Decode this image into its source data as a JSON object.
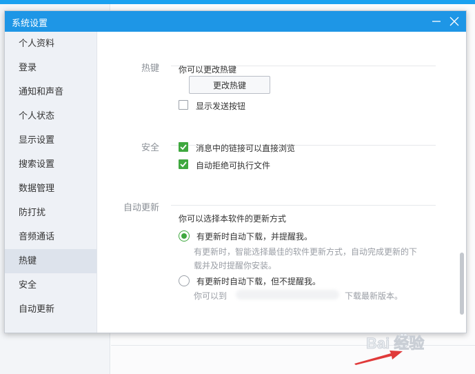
{
  "window": {
    "title": "系统设置"
  },
  "sidebar": {
    "items": [
      {
        "label": "个人资料"
      },
      {
        "label": "登录"
      },
      {
        "label": "通知和声音"
      },
      {
        "label": "个人状态"
      },
      {
        "label": "显示设置"
      },
      {
        "label": "搜索设置"
      },
      {
        "label": "数据管理"
      },
      {
        "label": "防打扰"
      },
      {
        "label": "音频通话"
      },
      {
        "label": "热键",
        "active": true
      },
      {
        "label": "安全"
      },
      {
        "label": "自动更新"
      }
    ]
  },
  "hotkey": {
    "section_label": "热键",
    "desc": "你可以更改热键",
    "button_label": "更改热键",
    "show_send_label": "显示发送按钮",
    "show_send_checked": false
  },
  "security": {
    "section_label": "安全",
    "option1_label": "消息中的链接可以直接浏览",
    "option1_checked": true,
    "option2_label": "自动拒绝可执行文件",
    "option2_checked": true
  },
  "update": {
    "section_label": "自动更新",
    "desc": "你可以选择本软件的更新方式",
    "option1_label": "有更新时自动下载，并提醒我。",
    "option1_desc_line1": "有更新时，智能选择最佳的软件更新方式，自动完成更新的下",
    "option1_desc_line2": "载并及时提醒你安装。",
    "option1_checked": true,
    "option2_label": "有更新时自动下载，但不提醒我。",
    "option2_desc_start": "你可以到",
    "option2_desc_end": "下载最新版本。",
    "option2_checked": false
  },
  "watermark": {
    "text": "Bai 经验",
    "icon": "paw-icon"
  },
  "colors": {
    "title_bar": "#1e96e6",
    "check_green": "#3fa83f",
    "active_nav": "#dde3ec"
  }
}
